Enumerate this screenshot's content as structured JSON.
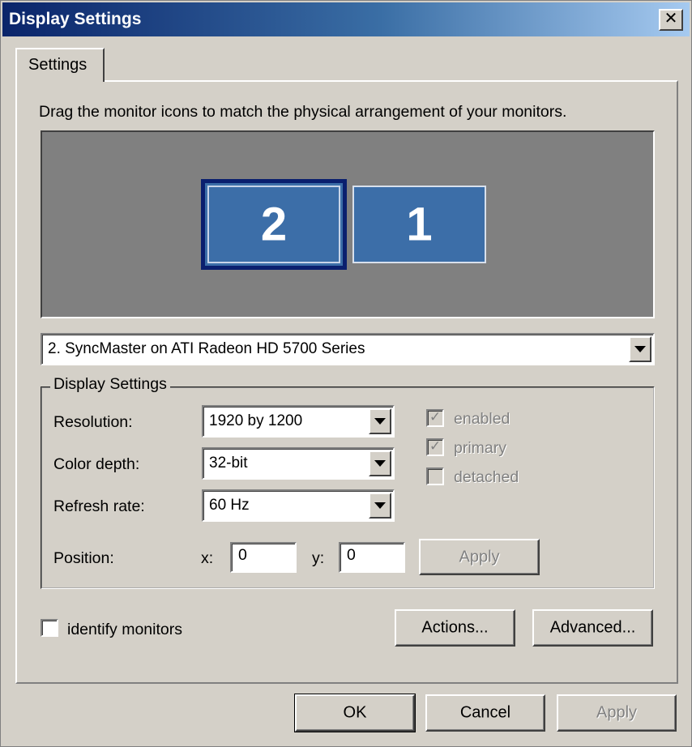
{
  "window": {
    "title": "Display Settings",
    "close_glyph": "✕"
  },
  "tab": {
    "label": "Settings"
  },
  "instruction": "Drag the monitor icons to match the physical arrangement of your monitors.",
  "monitors": [
    {
      "number": "2",
      "selected": true
    },
    {
      "number": "1",
      "selected": false
    }
  ],
  "display_select": {
    "value": "2. SyncMaster on ATI Radeon HD 5700 Series"
  },
  "group": {
    "legend": "Display Settings",
    "resolution": {
      "label": "Resolution:",
      "value": "1920 by 1200"
    },
    "color_depth": {
      "label": "Color depth:",
      "value": "32-bit"
    },
    "refresh_rate": {
      "label": "Refresh rate:",
      "value": "60 Hz"
    },
    "position": {
      "label": "Position:",
      "x_label": "x:",
      "x_value": "0",
      "y_label": "y:",
      "y_value": "0",
      "apply_label": "Apply"
    },
    "checkboxes": [
      {
        "label": "enabled",
        "checked": true
      },
      {
        "label": "primary",
        "checked": true
      },
      {
        "label": "detached",
        "checked": false
      }
    ]
  },
  "identify": {
    "label": "identify monitors",
    "checked": false
  },
  "buttons": {
    "actions": "Actions...",
    "advanced": "Advanced...",
    "ok": "OK",
    "cancel": "Cancel",
    "apply": "Apply"
  },
  "icons": {
    "close": "close-icon",
    "dropdown": "chevron-down-icon",
    "check": "checkmark-icon"
  },
  "colors": {
    "title_start": "#0a246a",
    "title_end": "#a6caf0",
    "monitor_fill": "#3c6ea8",
    "arrange_bg": "#808080",
    "face": "#d4d0c8"
  }
}
